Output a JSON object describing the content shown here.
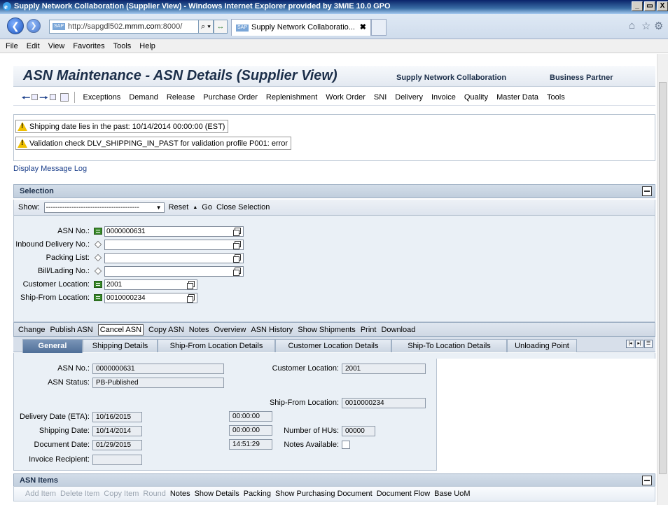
{
  "window": {
    "title": "Supply Network Collaboration (Supplier View) - Windows Internet Explorer provided by 3M/IE 10.0 GPO",
    "controls": [
      "_",
      "8",
      "X"
    ]
  },
  "browser": {
    "url_prefix": "http://sapgdl502.",
    "url_bold": "mmm.com",
    "url_suffix": ":8000/",
    "favicon_text": "SAP",
    "tab_title": "Supply Network Collaboratio...",
    "tab_close": "✖",
    "search_glyph": "⌕ ▾",
    "refresh_glyph": "↔"
  },
  "menu": [
    "File",
    "Edit",
    "View",
    "Favorites",
    "Tools",
    "Help"
  ],
  "header": {
    "title": "ASN Maintenance - ASN Details (Supplier View)",
    "link1": "Supply Network Collaboration",
    "link2": "Business Partner"
  },
  "nav": [
    "Exceptions",
    "Demand",
    "Release",
    "Purchase Order",
    "Replenishment",
    "Work Order",
    "SNI",
    "Delivery",
    "Invoice",
    "Quality",
    "Master Data",
    "Tools"
  ],
  "messages": [
    "Shipping date lies in the past: 10/14/2014 00:00:00 (EST)",
    "Validation check DLV_SHIPPING_IN_PAST for validation profile P001: error"
  ],
  "message_log_link": "Display Message Log",
  "selection": {
    "title": "Selection",
    "show_label": "Show:",
    "show_value": "----------------------------------------",
    "reset": "Reset",
    "go": "Go",
    "close": "Close Selection",
    "fields": [
      {
        "label": "ASN No.:",
        "value": "0000000631",
        "indicator": "equals"
      },
      {
        "label": "Inbound Delivery No.:",
        "value": "",
        "indicator": "diamond"
      },
      {
        "label": "Packing List:",
        "value": "",
        "indicator": "diamond"
      },
      {
        "label": "Bill/Lading No.:",
        "value": "",
        "indicator": "diamond"
      },
      {
        "label": "Customer Location:",
        "value": "2001",
        "indicator": "equals"
      },
      {
        "label": "Ship-From Location:",
        "value": "0010000234",
        "indicator": "equals"
      }
    ]
  },
  "actions": [
    "Change",
    "Publish ASN",
    "Cancel ASN",
    "Copy ASN",
    "Notes",
    "Overview",
    "ASN History",
    "Show Shipments",
    "Print",
    "Download"
  ],
  "tabs": [
    "General",
    "Shipping Details",
    "Ship-From Location Details",
    "Customer Location Details",
    "Ship-To Location Details",
    "Unloading Point"
  ],
  "tab_nav": [
    "|◂",
    "▸|",
    "☰"
  ],
  "general": {
    "asn_no_label": "ASN No.:",
    "asn_no": "0000000631",
    "asn_status_label": "ASN Status:",
    "asn_status": "PB-Published",
    "customer_location_label": "Customer Location:",
    "customer_location": "2001",
    "ship_from_label": "Ship-From Location:",
    "ship_from": "0010000234",
    "delivery_date_label": "Delivery Date (ETA):",
    "delivery_date": "10/16/2015",
    "delivery_time": "00:00:00",
    "shipping_date_label": "Shipping Date:",
    "shipping_date": "10/14/2014",
    "shipping_time": "00:00:00",
    "document_date_label": "Document Date:",
    "document_date": "01/29/2015",
    "document_time": "14:51:29",
    "num_hus_label": "Number of HUs:",
    "num_hus": "00000",
    "notes_available_label": "Notes Available:",
    "invoice_recipient_label": "Invoice Recipient:",
    "invoice_recipient": ""
  },
  "items": {
    "title": "ASN Items",
    "actions_disabled": [
      "Add Item",
      "Delete Item",
      "Copy Item",
      "Round"
    ],
    "actions": [
      "Notes",
      "Show Details",
      "Packing",
      "Show Purchasing Document",
      "Document Flow",
      "Base UoM"
    ]
  }
}
